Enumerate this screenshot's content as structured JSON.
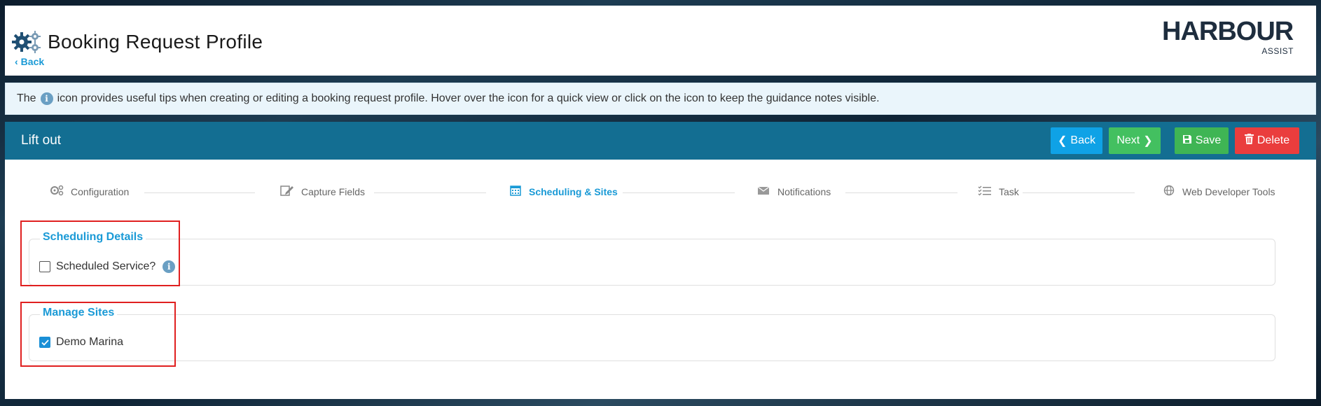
{
  "header": {
    "title": "Booking Request Profile",
    "back_label": "Back",
    "logo_text": "HARBOUR",
    "logo_subtext": "ASSIST"
  },
  "info_bar": {
    "text_before": "The",
    "info_glyph": "i",
    "text_after": "icon provides useful tips when creating or editing a booking request profile. Hover over the icon for a quick view or click on the icon to keep the guidance notes visible."
  },
  "panel": {
    "title": "Lift out",
    "buttons": {
      "back": "Back",
      "next": "Next",
      "save": "Save",
      "delete": "Delete"
    }
  },
  "steps": [
    {
      "label": "Configuration",
      "icon": "gears-icon",
      "active": false
    },
    {
      "label": "Capture Fields",
      "icon": "edit-icon",
      "active": false
    },
    {
      "label": "Scheduling & Sites",
      "icon": "calendar-icon",
      "active": true
    },
    {
      "label": "Notifications",
      "icon": "envelope-icon",
      "active": false
    },
    {
      "label": "Task",
      "icon": "checklist-icon",
      "active": false
    },
    {
      "label": "Web Developer Tools",
      "icon": "globe-icon",
      "active": false
    }
  ],
  "scheduling": {
    "legend": "Scheduling Details",
    "checkbox_label": "Scheduled Service?",
    "checked": false,
    "info_glyph": "i"
  },
  "sites": {
    "legend": "Manage Sites",
    "checkbox_label": "Demo Marina",
    "checked": true
  },
  "colors": {
    "panel_header": "#136e92",
    "accent": "#1a9ad6",
    "back_button": "#0fa2e6",
    "next_button": "#43c060",
    "save_button": "#3fb554",
    "delete_button": "#ea3d3d",
    "highlight_box": "#e02020"
  }
}
